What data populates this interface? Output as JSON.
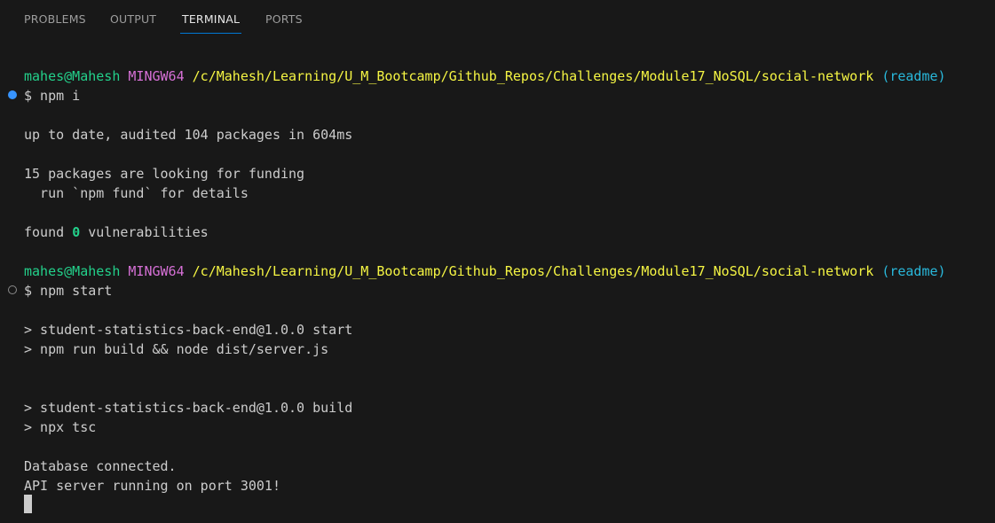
{
  "tabs": [
    {
      "label": "PROBLEMS",
      "active": false
    },
    {
      "label": "OUTPUT",
      "active": false
    },
    {
      "label": "TERMINAL",
      "active": true
    },
    {
      "label": "PORTS",
      "active": false
    }
  ],
  "prompt": {
    "user": "mahes@Mahesh",
    "host": "MINGW64",
    "path": "/c/Mahesh/Learning/U_M_Bootcamp/Github_Repos/Challenges/Module17_NoSQL/social-network",
    "branch": "(readme)"
  },
  "commands": {
    "first": "$ npm i",
    "second": "$ npm start"
  },
  "output": {
    "audit": "up to date, audited 104 packages in 604ms",
    "funding": "15 packages are looking for funding",
    "fund_hint": "  run `npm fund` for details",
    "vuln_prefix": "found ",
    "vuln_count": "0",
    "vuln_suffix": " vulnerabilities",
    "start_script": "> student-statistics-back-end@1.0.0 start",
    "start_cmd": "> npm run build && node dist/server.js",
    "build_script": "> student-statistics-back-end@1.0.0 build",
    "build_cmd": "> npx tsc",
    "db": "Database connected.",
    "server": "API server running on port 3001!"
  },
  "colors": {
    "background": "#181818",
    "tab_active_border": "#0078d4",
    "prompt_user": "#23d18b",
    "prompt_host": "#d670d6",
    "prompt_path": "#f5f543",
    "prompt_branch": "#29b8db",
    "command_success_dot": "#3794ff"
  }
}
